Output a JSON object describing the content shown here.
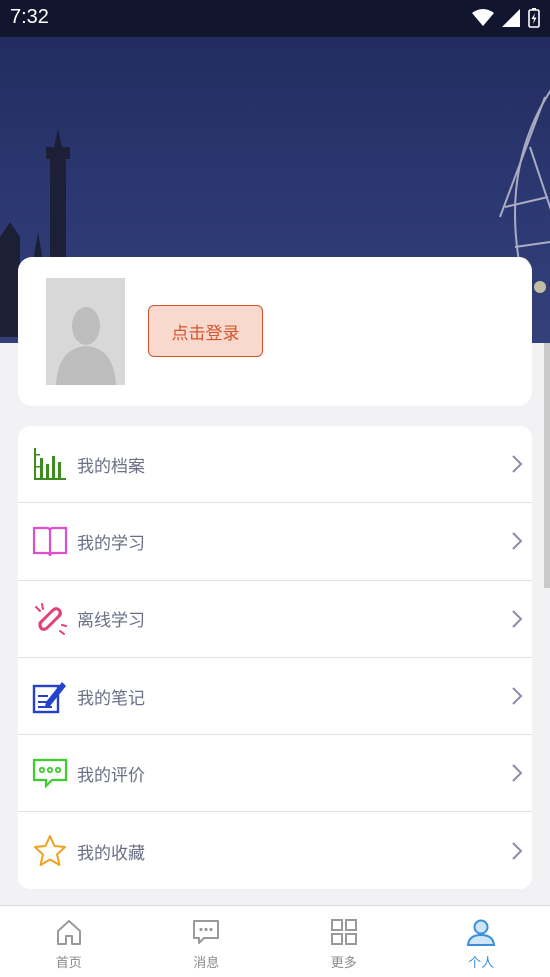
{
  "status_bar": {
    "time": "7:32"
  },
  "profile": {
    "login_label": "点击登录"
  },
  "menu": {
    "items": [
      {
        "label": "我的档案",
        "icon": "bar-chart-icon",
        "color": "#3c8c1e"
      },
      {
        "label": "我的学习",
        "icon": "open-book-icon",
        "color": "#e04fd3"
      },
      {
        "label": "离线学习",
        "icon": "disconnected-link-icon",
        "color": "#e43f77"
      },
      {
        "label": "我的笔记",
        "icon": "note-pen-icon",
        "color": "#2441c9"
      },
      {
        "label": "我的评价",
        "icon": "comment-bubble-icon",
        "color": "#3ecf2d"
      },
      {
        "label": "我的收藏",
        "icon": "star-icon",
        "color": "#f0a021"
      }
    ]
  },
  "tabbar": {
    "tabs": [
      {
        "label": "首页",
        "icon": "home-icon"
      },
      {
        "label": "消息",
        "icon": "message-icon"
      },
      {
        "label": "更多",
        "icon": "grid-icon"
      },
      {
        "label": "个人",
        "icon": "person-icon",
        "active": true
      }
    ]
  },
  "colors": {
    "accent": "#3a8fd8",
    "login_border": "#d2552e",
    "login_fill": "#f9d9ce"
  }
}
